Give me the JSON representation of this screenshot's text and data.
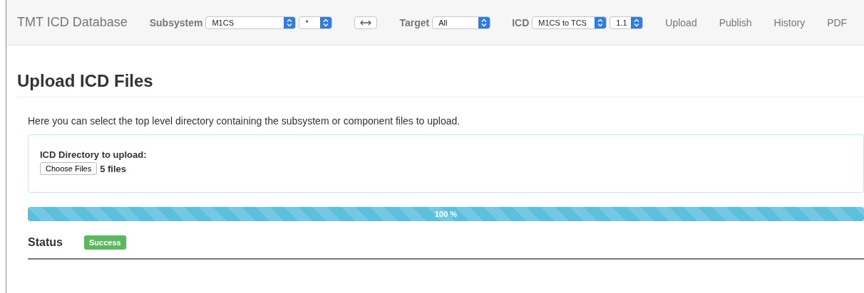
{
  "navbar": {
    "brand": "TMT ICD Database",
    "subsystem": {
      "label": "Subsystem",
      "value": "M1CS",
      "version": "*"
    },
    "target": {
      "label": "Target",
      "value": "All"
    },
    "icd": {
      "label": "ICD",
      "value": "M1CS to TCS",
      "version": "1.1"
    },
    "links": [
      "Upload",
      "Publish",
      "History",
      "PDF"
    ]
  },
  "page": {
    "title": "Upload ICD Files",
    "intro": "Here you can select the top level directory containing the subsystem or component files to upload.",
    "upload": {
      "label": "ICD Directory to upload:",
      "button": "Choose Files",
      "chosen": "5 files"
    },
    "progress": {
      "level": 1.0,
      "reading": "100 %"
    },
    "status": {
      "label": "Status",
      "badge": "Success",
      "kind": "success"
    }
  }
}
